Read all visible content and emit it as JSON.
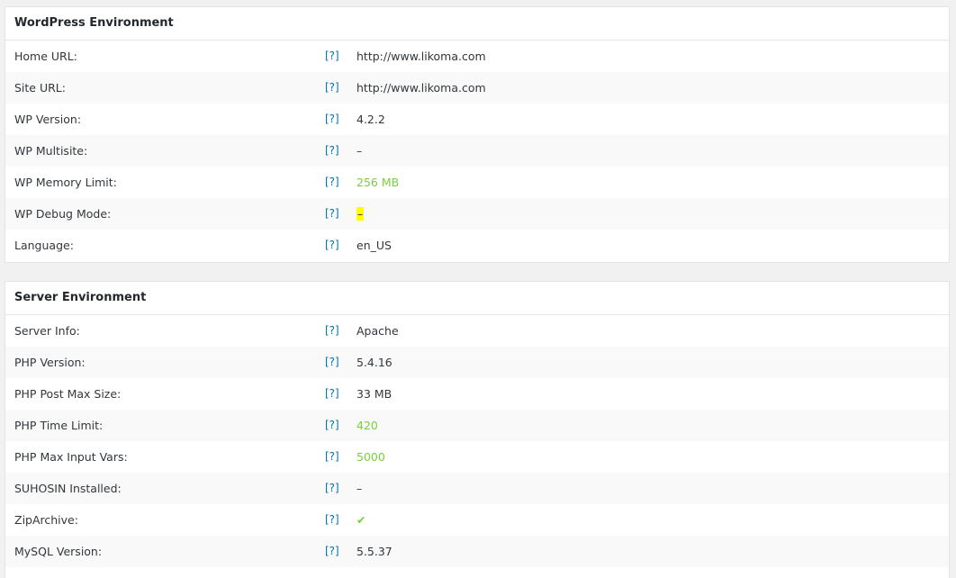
{
  "colors": {
    "help_link": "#0073aa",
    "good_value": "#7ad03a",
    "highlight": "#ffff00"
  },
  "wordpress": {
    "title": "WordPress Environment",
    "rows": [
      {
        "label": "Home URL:",
        "help": "[?]",
        "value": "http://www.likoma.com"
      },
      {
        "label": "Site URL:",
        "help": "[?]",
        "value": "http://www.likoma.com"
      },
      {
        "label": "WP Version:",
        "help": "[?]",
        "value": "4.2.2"
      },
      {
        "label": "WP Multisite:",
        "help": "[?]",
        "value": "–"
      },
      {
        "label": "WP Memory Limit:",
        "help": "[?]",
        "value": "256 MB"
      },
      {
        "label": "WP Debug Mode:",
        "help": "[?]",
        "value": "–"
      },
      {
        "label": "Language:",
        "help": "[?]",
        "value": "en_US"
      }
    ]
  },
  "server": {
    "title": "Server Environment",
    "rows": [
      {
        "label": "Server Info:",
        "help": "[?]",
        "value": "Apache"
      },
      {
        "label": "PHP Version:",
        "help": "[?]",
        "value": "5.4.16"
      },
      {
        "label": "PHP Post Max Size:",
        "help": "[?]",
        "value": "33 MB"
      },
      {
        "label": "PHP Time Limit:",
        "help": "[?]",
        "value": "420"
      },
      {
        "label": "PHP Max Input Vars:",
        "help": "[?]",
        "value": "5000"
      },
      {
        "label": "SUHOSIN Installed:",
        "help": "[?]",
        "value": "–"
      },
      {
        "label": "ZipArchive:",
        "help": "[?]",
        "value": "✔"
      },
      {
        "label": "MySQL Version:",
        "help": "[?]",
        "value": "5.5.37"
      }
    ]
  }
}
